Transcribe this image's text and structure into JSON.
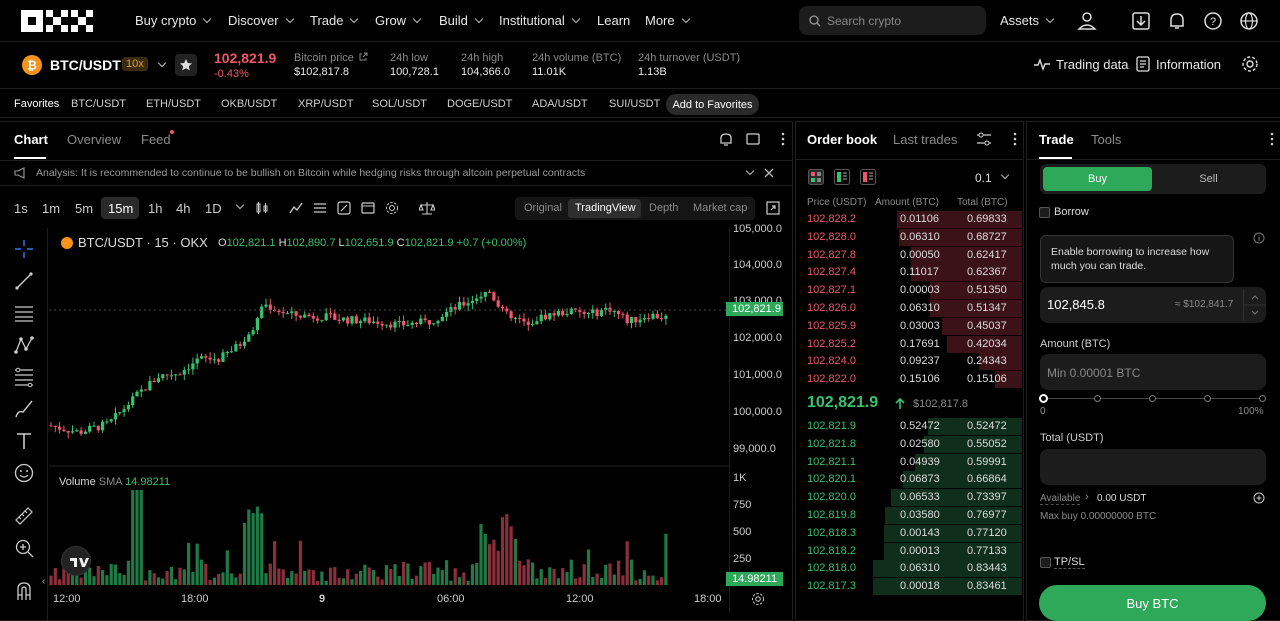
{
  "nav": {
    "items": [
      "Buy crypto",
      "Discover",
      "Trade",
      "Grow",
      "Build",
      "Institutional",
      "Learn",
      "More"
    ],
    "search_placeholder": "Search crypto",
    "assets": "Assets"
  },
  "ticker": {
    "pair": "BTC/USDT",
    "leverage": "10x",
    "price": "102,821.9",
    "change": "-0.43%",
    "stats": [
      {
        "label": "Bitcoin price",
        "value": "$102,817.8"
      },
      {
        "label": "24h low",
        "value": "100,728.1"
      },
      {
        "label": "24h high",
        "value": "104,366.0"
      },
      {
        "label": "24h volume (BTC)",
        "value": "11.01K"
      },
      {
        "label": "24h turnover (USDT)",
        "value": "1.13B"
      }
    ],
    "trading_data": "Trading data",
    "information": "Information"
  },
  "favorites": {
    "title": "Favorites",
    "pairs": [
      "BTC/USDT",
      "ETH/USDT",
      "OKB/USDT",
      "XRP/USDT",
      "SOL/USDT",
      "DOGE/USDT",
      "ADA/USDT",
      "SUI/USDT"
    ],
    "add": "Add to Favorites"
  },
  "chart_panel": {
    "tabs": [
      "Chart",
      "Overview",
      "Feed"
    ],
    "analysis": "Analysis: It is recommended to continue to be bullish on Bitcoin while hedging risks through altcoin perpetual contracts",
    "timeframes": [
      "1s",
      "1m",
      "5m",
      "15m",
      "1h",
      "4h",
      "1D"
    ],
    "active_timeframe": "15m",
    "views": [
      "Original",
      "TradingView",
      "Depth",
      "Market cap"
    ],
    "active_view": "TradingView",
    "legend_symbol": "BTC/USDT · 15 · OKX",
    "ohlc": {
      "o": "102,821.1",
      "h": "102,890.7",
      "l": "102,651.9",
      "c": "102,821.9",
      "chg": "+0.7 (+0.00%)"
    },
    "price_ticks": [
      "104,000.0",
      "103,000.0",
      "102,000.0",
      "101,000.0",
      "100,000.0",
      "99,000.0"
    ],
    "top_tick": "105,000.0",
    "last_price_label": "102,821.9",
    "volume_label": "Volume",
    "volume_sma": "SMA",
    "volume_sma_value": "14.98211",
    "volume_ticks": [
      "1K",
      "750",
      "500",
      "250"
    ],
    "volume_last": "14.98211",
    "time_ticks": [
      "12:00",
      "18:00",
      "9",
      "06:00",
      "12:00",
      "18:00"
    ]
  },
  "chart_data": {
    "type": "candlestick",
    "y_range": [
      98400,
      105300
    ],
    "candles": []
  },
  "orderbook": {
    "tabs": [
      "Order book",
      "Last trades"
    ],
    "precision": "0.1",
    "headers": [
      "Price (USDT)",
      "Amount (BTC)",
      "Total (BTC)"
    ],
    "asks": [
      [
        "102,828.2",
        "0.01106",
        "0.69833"
      ],
      [
        "102,828.0",
        "0.06310",
        "0.68727"
      ],
      [
        "102,827.8",
        "0.00050",
        "0.62417"
      ],
      [
        "102,827.4",
        "0.11017",
        "0.62367"
      ],
      [
        "102,827.1",
        "0.00003",
        "0.51350"
      ],
      [
        "102,826.0",
        "0.06310",
        "0.51347"
      ],
      [
        "102,825.9",
        "0.03003",
        "0.45037"
      ],
      [
        "102,825.2",
        "0.17691",
        "0.42034"
      ],
      [
        "102,824.0",
        "0.09237",
        "0.24343"
      ],
      [
        "102,822.0",
        "0.15106",
        "0.15106"
      ]
    ],
    "mid_price": "102,821.9",
    "mid_usd": "$102,817.8",
    "bids": [
      [
        "102,821.9",
        "0.52472",
        "0.52472"
      ],
      [
        "102,821.8",
        "0.02580",
        "0.55052"
      ],
      [
        "102,821.1",
        "0.04939",
        "0.59991"
      ],
      [
        "102,820.1",
        "0.06873",
        "0.66864"
      ],
      [
        "102,820.0",
        "0.06533",
        "0.73397"
      ],
      [
        "102,819.8",
        "0.03580",
        "0.76977"
      ],
      [
        "102,818.3",
        "0.00143",
        "0.77120"
      ],
      [
        "102,818.2",
        "0.00013",
        "0.77133"
      ],
      [
        "102,818.0",
        "0.06310",
        "0.83443"
      ],
      [
        "102,817.3",
        "0.00018",
        "0.83461"
      ]
    ]
  },
  "trade": {
    "tabs": [
      "Trade",
      "Tools"
    ],
    "buy": "Buy",
    "sell": "Sell",
    "borrow": "Borrow",
    "borrow_tip": "Enable borrowing to increase how much you can trade.",
    "price_value": "102,845.8",
    "price_usd": "≈ $102,841.7",
    "amount_label": "Amount (BTC)",
    "amount_placeholder": "Min 0.00001 BTC",
    "slider_min": "0",
    "slider_max": "100%",
    "total_label": "Total (USDT)",
    "available_label": "Available",
    "available_value": "0.00 USDT",
    "maxbuy": "Max buy 0.00000000 BTC",
    "tpsl": "TP/SL",
    "submit": "Buy BTC"
  },
  "colors": {
    "up": "#36c26e",
    "down": "#f0566b",
    "accent_green": "#2ea95a"
  }
}
